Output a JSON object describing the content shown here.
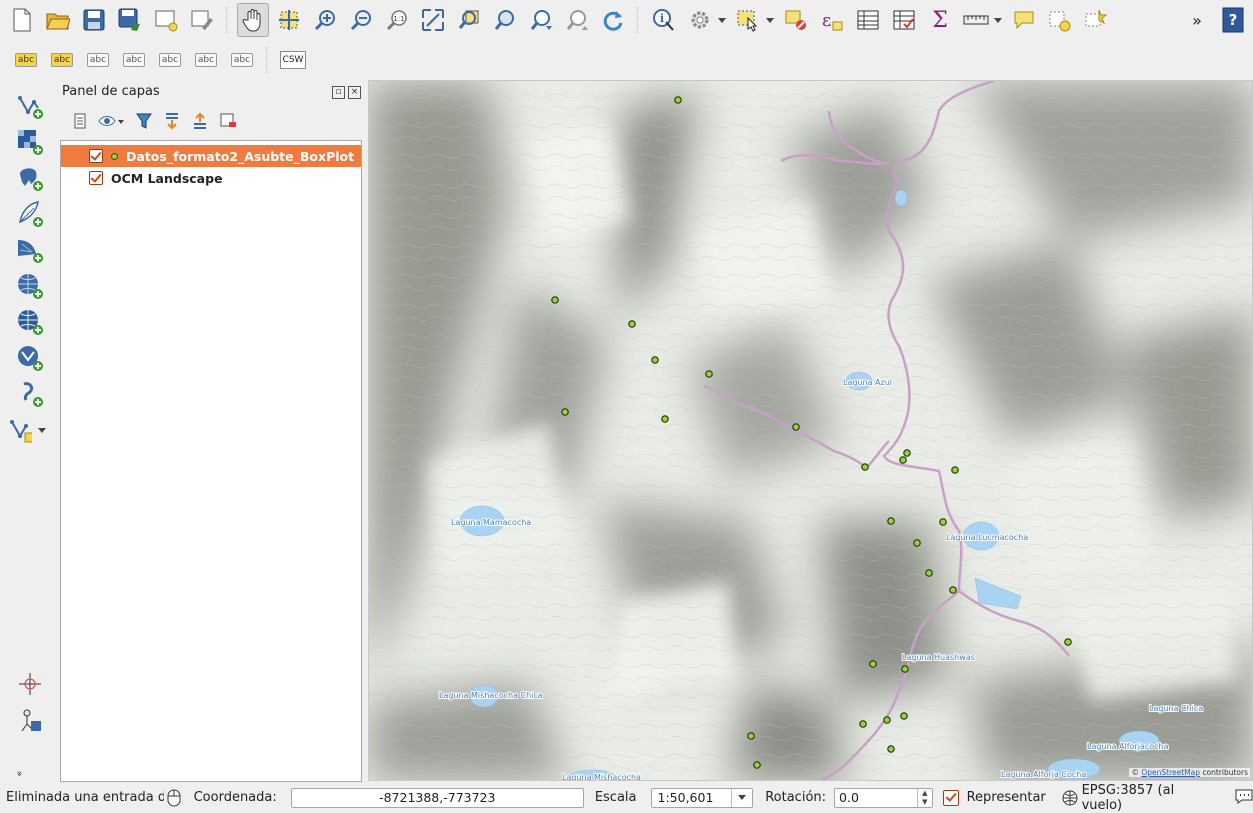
{
  "layers_panel": {
    "title": "Panel de capas",
    "layers": [
      {
        "name": "Datos_formato2_Asubte_BoxPlot",
        "checked": true,
        "active": true
      },
      {
        "name": "OCM Landscape",
        "checked": true,
        "active": false
      }
    ]
  },
  "map": {
    "lake_labels": [
      "Laguna Azul",
      "Laguna Mamacocha",
      "Laguna Lucmacocha",
      "Laguna Huashwas",
      "Laguna Mishacocha Chica",
      "Laguna Chica",
      "Laguna Alforjacocha",
      "Laguna Mishacocha",
      "Laguna Alforja Cocha"
    ],
    "attribution_prefix": "©",
    "attribution_link": "OpenStreetMap",
    "attribution_suffix": "contributors",
    "point_color": "#9bd13a",
    "route_color": "#c9a0c8"
  },
  "status_bar": {
    "message": "Eliminada una entrada de la",
    "coord_label": "Coordenada:",
    "coord_value": "-8721388,-773723",
    "scale_label": "Escala",
    "scale_value": "1:50,601",
    "rotation_label": "Rotación:",
    "rotation_value": "0.0",
    "render_label": "Representar",
    "crs_label": "EPSG:3857 (al vuelo)"
  },
  "toolbar_label_buttons": [
    "abc",
    "abc",
    "abc",
    "abc",
    "abc",
    "abc",
    "abc"
  ],
  "toolbar_csw": "CSW",
  "toolbar_overflow": "»",
  "toolbar_identity_glyph": "ε",
  "toolbar_sigma": "Σ",
  "toolbar_help": "?",
  "toolbar_zoom_native": "1:1",
  "hidden_expand": "»"
}
